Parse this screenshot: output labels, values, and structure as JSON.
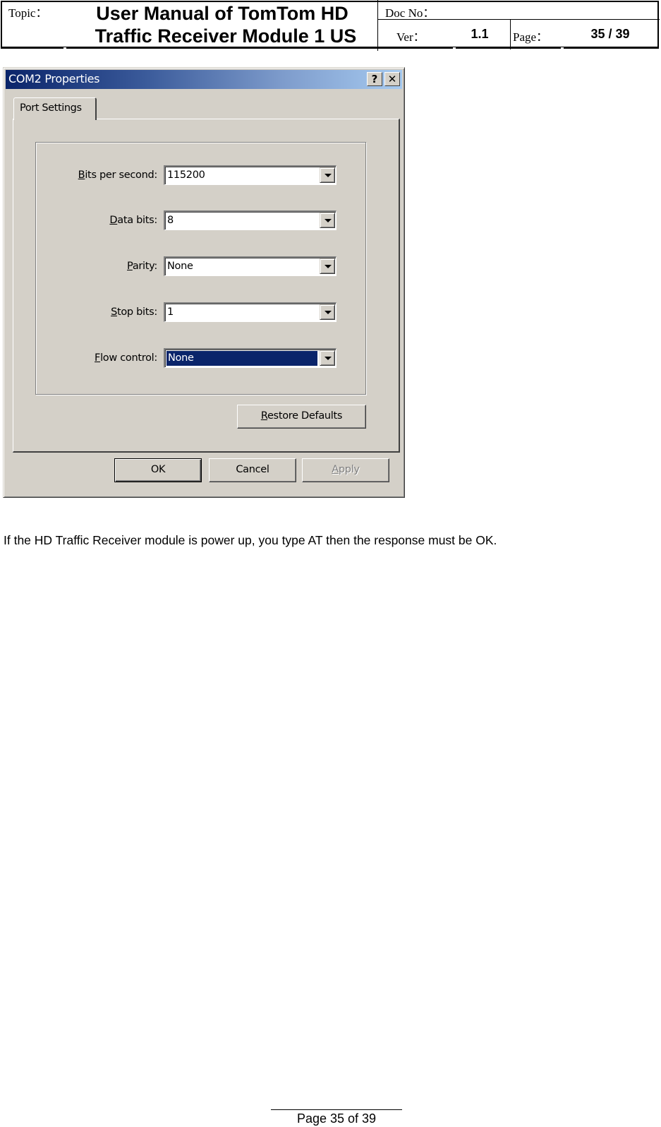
{
  "header": {
    "topic_label": "Topic：",
    "title_line1": "User Manual of TomTom HD",
    "title_line2": "Traffic Receiver Module 1 US",
    "doc_no_label": "Doc No：",
    "doc_no_value": "",
    "ver_label": "Ver：",
    "ver_value": "1.1",
    "page_label": "Page：",
    "page_value": "35 / 39"
  },
  "dialog": {
    "title": "COM2 Properties",
    "help_button": "?",
    "close_button": "✕",
    "tab_label": "Port Settings",
    "fields": [
      {
        "label_mnemonic": "B",
        "label_rest": "its per second:",
        "value": "115200",
        "selected": false
      },
      {
        "label_mnemonic": "D",
        "label_rest": "ata bits:",
        "value": "8",
        "selected": false
      },
      {
        "label_mnemonic": "P",
        "label_rest": "arity:",
        "value": "None",
        "selected": false
      },
      {
        "label_mnemonic": "S",
        "label_rest": "top bits:",
        "value": "1",
        "selected": false
      },
      {
        "label_mnemonic": "F",
        "label_rest": "low control:",
        "value": "None",
        "selected": true
      }
    ],
    "restore_defaults": {
      "mnemonic": "R",
      "rest": "estore Defaults"
    },
    "ok_label": "OK",
    "cancel_label": "Cancel",
    "apply": {
      "mnemonic": "A",
      "rest": "pply",
      "enabled": false
    },
    "colors": {
      "face": "#d4d0c8",
      "selection": "#0a246a",
      "title_gradient_start": "#0a246a",
      "title_gradient_end": "#a6caf0"
    }
  },
  "body": {
    "paragraph": "If the HD Traffic Receiver module is power up, you type AT then the response must be OK."
  },
  "footer": {
    "page_text": "Page 35 of 39"
  }
}
